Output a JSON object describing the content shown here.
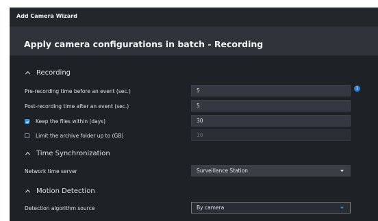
{
  "window": {
    "title": "Add Camera Wizard"
  },
  "header": {
    "title": "Apply camera configurations in batch - Recording"
  },
  "sections": {
    "recording": "Recording",
    "time_sync": "Time Synchronization",
    "motion": "Motion Detection"
  },
  "recording": {
    "pre_label": "Pre-recording time before an event (sec.)",
    "pre_value": "5",
    "post_label": "Post-recording time after an event (sec.)",
    "post_value": "5",
    "keep_label": "Keep the files within (days)",
    "keep_value": "30",
    "keep_checked": true,
    "limit_label": "Limit the archive folder up to (GB)",
    "limit_value": "10",
    "limit_checked": false
  },
  "time_sync": {
    "server_label": "Network time server",
    "server_value": "Surveillance Station"
  },
  "motion": {
    "source_label": "Detection algorithm source",
    "source_value": "By camera"
  },
  "icons": {
    "info": "info-icon",
    "caret": "caret-up-icon",
    "dropdown": "chevron-down-icon"
  },
  "colors": {
    "accent": "#3a8fd9",
    "background": "#1e2126"
  }
}
